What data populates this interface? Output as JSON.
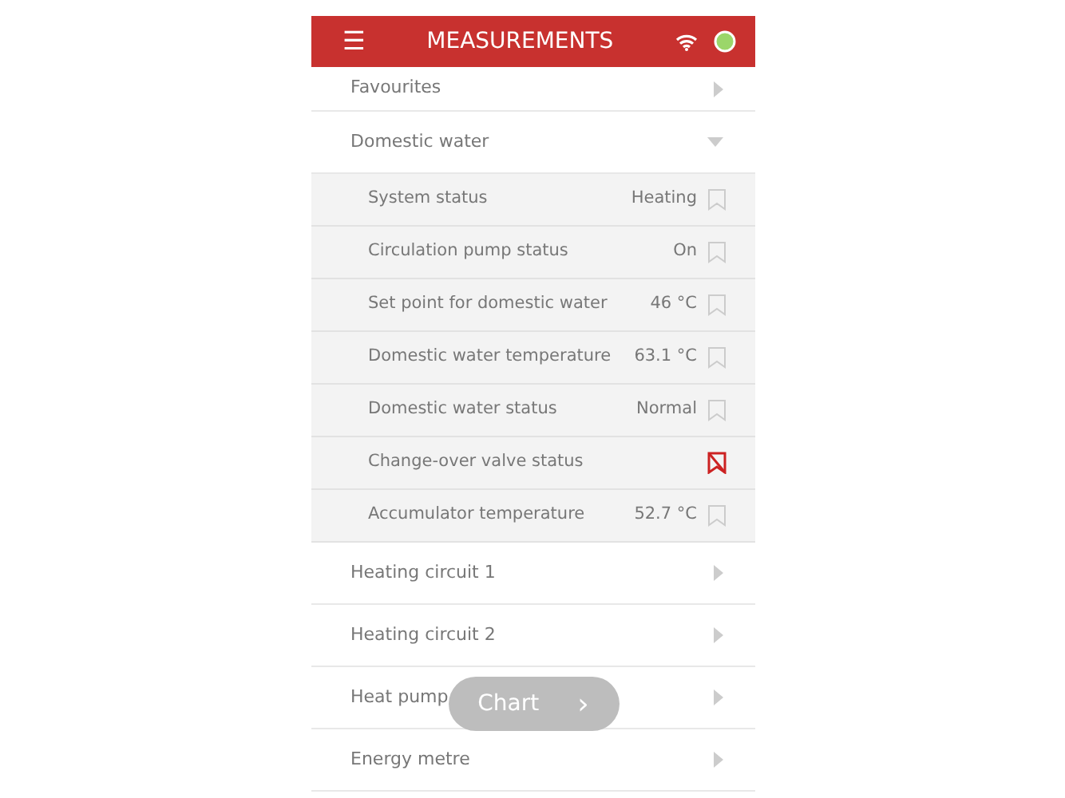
{
  "header": {
    "menu_glyph": "☰",
    "title": "MEASUREMENTS",
    "connected": true
  },
  "groups": [
    {
      "label": "Favourites",
      "expanded": false
    },
    {
      "label": "Domestic water",
      "expanded": true,
      "items": [
        {
          "label": "System status",
          "value": "Heating",
          "bookmarked": false
        },
        {
          "label": "Circulation pump status",
          "value": "On",
          "bookmarked": false
        },
        {
          "label": "Set point for domestic water",
          "value": "46 °C",
          "bookmarked": false
        },
        {
          "label": "Domestic water temperature",
          "value": "63.1 °C",
          "bookmarked": false
        },
        {
          "label": "Domestic water status",
          "value": "Normal",
          "bookmarked": false
        },
        {
          "label": "Change-over valve status",
          "bookmarked": true
        },
        {
          "label": "Accumulator temperature",
          "value": "52.7 °C",
          "bookmarked": false
        }
      ]
    },
    {
      "label": "Heating circuit 1",
      "expanded": false
    },
    {
      "label": "Heating circuit 2",
      "expanded": false
    },
    {
      "label": "Heat pump",
      "expanded": false
    },
    {
      "label": "Energy metre",
      "expanded": false
    }
  ],
  "chart_button": {
    "label": "Chart",
    "glyph": "›"
  }
}
